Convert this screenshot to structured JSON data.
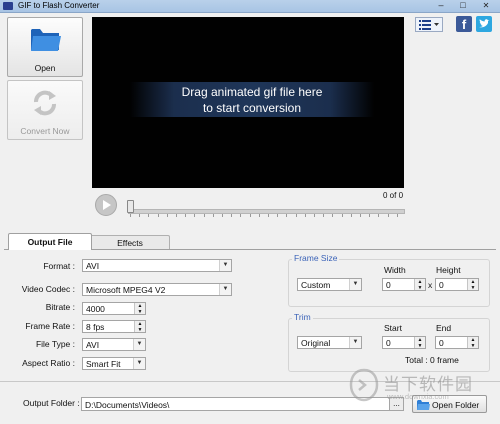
{
  "window": {
    "title": "GIF to Flash Converter",
    "minimize": "–",
    "maximize": "□",
    "close": "✕"
  },
  "toolbar": {
    "open_label": "Open",
    "convert_label": "Convert Now"
  },
  "preview": {
    "hint_line1": "Drag animated gif file here",
    "hint_line2": "to start conversion",
    "counter": "0 of 0"
  },
  "social": {
    "facebook": "f",
    "twitter": "twitter-icon",
    "menu": "list-icon"
  },
  "tabs": [
    {
      "label": "Output File",
      "active": true
    },
    {
      "label": "Effects",
      "active": false
    }
  ],
  "form": {
    "format_label": "Format :",
    "format_value": "AVI",
    "video_codec_label": "Video Codec :",
    "video_codec_value": "Microsoft MPEG4 V2",
    "bitrate_label": "Bitrate :",
    "bitrate_value": "4000",
    "frame_rate_label": "Frame Rate :",
    "frame_rate_value": "8 fps",
    "file_type_label": "File Type :",
    "file_type_value": "AVI",
    "aspect_ratio_label": "Aspect Ratio :",
    "aspect_ratio_value": "Smart Fit"
  },
  "frame_size": {
    "legend": "Frame Size",
    "mode": "Custom",
    "width_label": "Width",
    "height_label": "Height",
    "width_value": "0",
    "height_value": "0",
    "times": "x"
  },
  "trim": {
    "legend": "Trim",
    "mode": "Original",
    "start_label": "Start",
    "end_label": "End",
    "start_value": "0",
    "end_value": "0",
    "total": "Total : 0 frame"
  },
  "output": {
    "folder_label": "Output Folder :",
    "folder_value": "D:\\Documents\\Videos\\",
    "browse_label": "...",
    "open_folder_label": "Open Folder"
  },
  "watermark": {
    "text": "当下软件园",
    "url": "www.downxia.com"
  },
  "colors": {
    "legend_blue": "#3b63b8",
    "preview_bg": "#010101",
    "folder_blue": "#2f7fd6"
  }
}
